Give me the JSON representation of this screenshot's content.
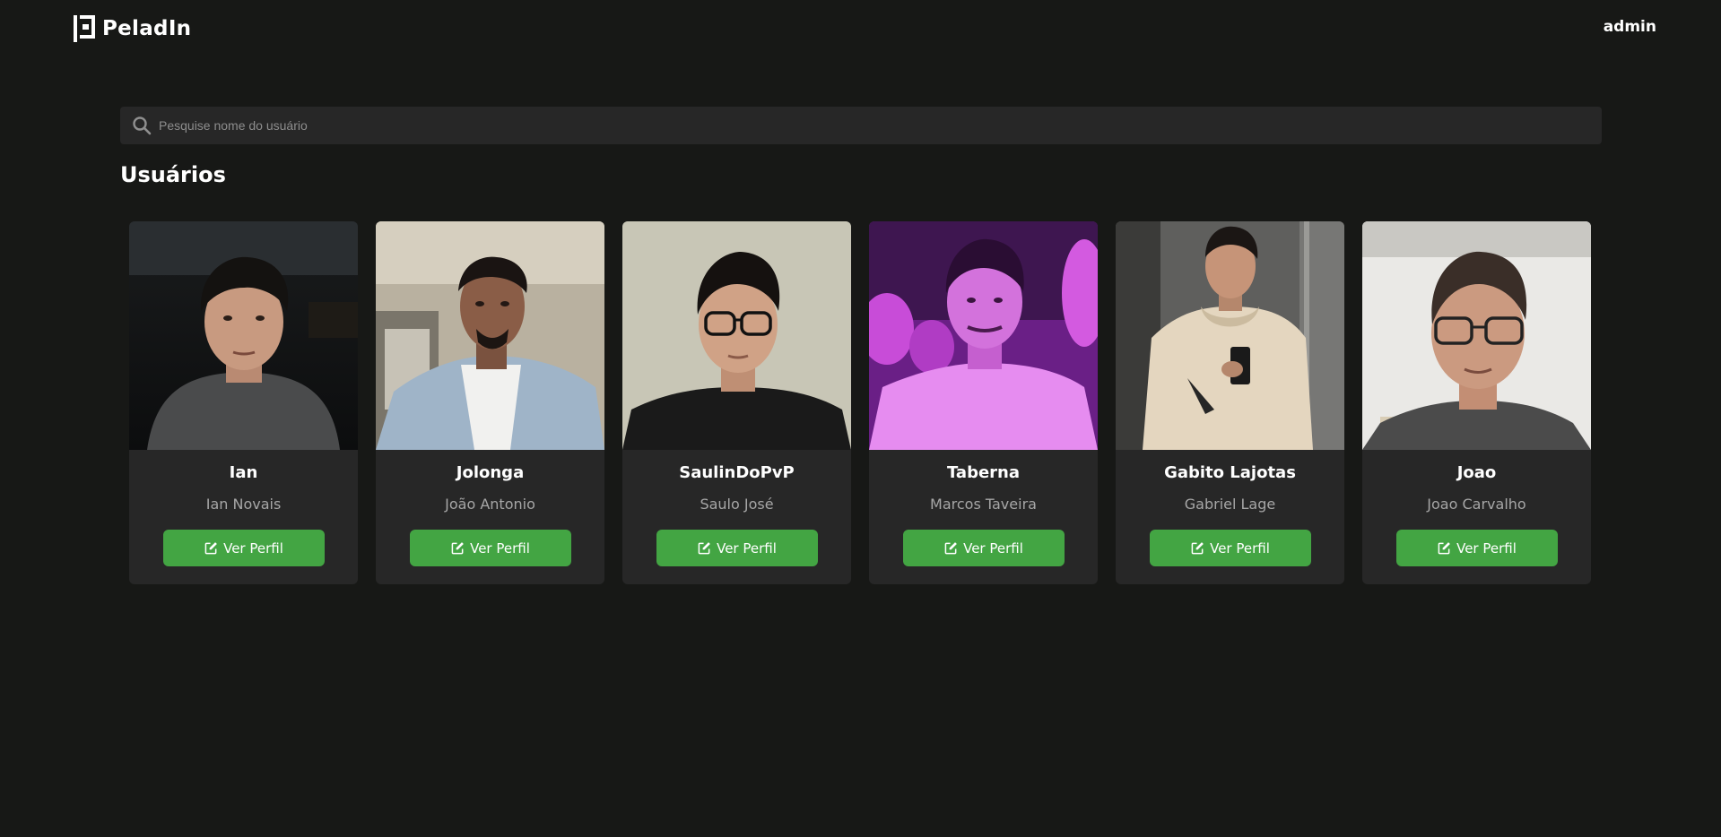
{
  "navbar": {
    "brand_name": "PeladIn",
    "user_label": "admin"
  },
  "search": {
    "placeholder": "Pesquise nome do usuário",
    "value": ""
  },
  "section_title": "Usuários",
  "users": [
    {
      "nick": "Ian",
      "name": "Ian Novais",
      "button_label": "Ver Perfil"
    },
    {
      "nick": "Jolonga",
      "name": "João Antonio",
      "button_label": "Ver Perfil"
    },
    {
      "nick": "SaulinDoPvP",
      "name": "Saulo José",
      "button_label": "Ver Perfil"
    },
    {
      "nick": "Taberna",
      "name": "Marcos Taveira",
      "button_label": "Ver Perfil"
    },
    {
      "nick": "Gabito Lajotas",
      "name": "Gabriel Lage",
      "button_label": "Ver Perfil"
    },
    {
      "nick": "Joao",
      "name": "Joao Carvalho",
      "button_label": "Ver Perfil"
    }
  ],
  "colors": {
    "background": "#171816",
    "card": "#272727",
    "accent_green": "#43a543",
    "muted_text": "#a6a6a6"
  }
}
